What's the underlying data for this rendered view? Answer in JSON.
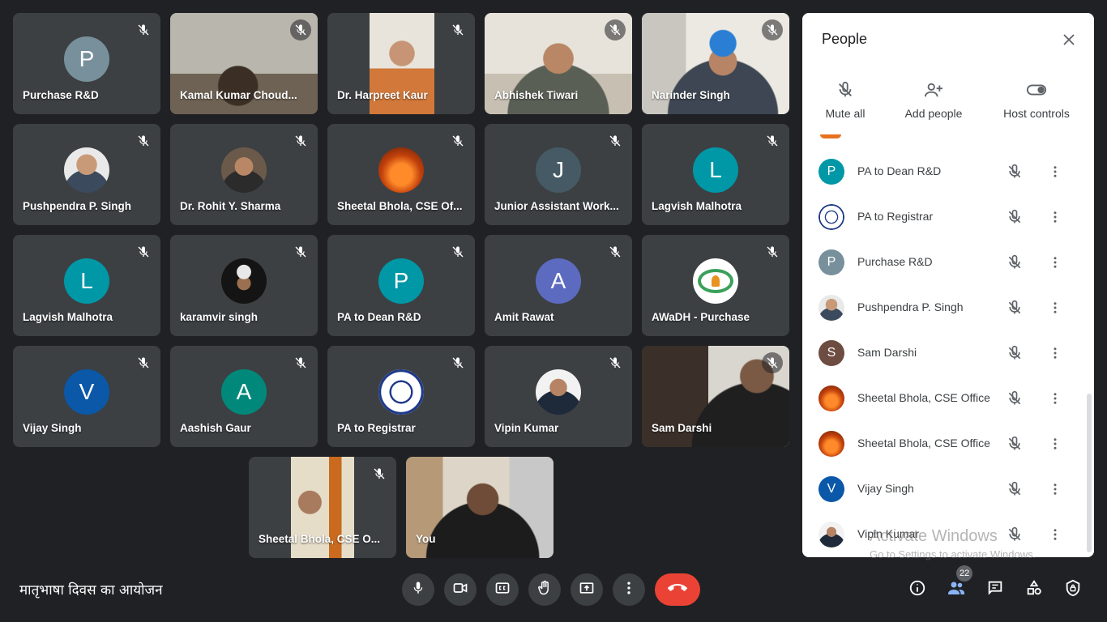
{
  "meeting": {
    "title": "मातृभाषा दिवस का आयोजन"
  },
  "tiles": [
    {
      "name": "Purchase R&D",
      "initial": "P",
      "color": "#78909c"
    },
    {
      "name": "Kamal Kumar Choud..."
    },
    {
      "name": "Dr. Harpreet Kaur"
    },
    {
      "name": "Abhishek Tiwari"
    },
    {
      "name": "Narinder Singh"
    },
    {
      "name": "Pushpendra P. Singh"
    },
    {
      "name": "Dr. Rohit Y. Sharma"
    },
    {
      "name": "Sheetal Bhola, CSE Of..."
    },
    {
      "name": "Junior Assistant Work...",
      "initial": "J",
      "color": "#455a64"
    },
    {
      "name": "Lagvish Malhotra",
      "initial": "L",
      "color": "#0097a7"
    },
    {
      "name": "Lagvish Malhotra",
      "initial": "L",
      "color": "#0097a7"
    },
    {
      "name": "karamvir singh"
    },
    {
      "name": "PA to Dean R&D",
      "initial": "P",
      "color": "#0097a7"
    },
    {
      "name": "Amit Rawat",
      "initial": "A",
      "color": "#5c6bc0"
    },
    {
      "name": "AWaDH - Purchase"
    },
    {
      "name": "Vijay Singh",
      "initial": "V",
      "color": "#0b57a8"
    },
    {
      "name": "Aashish Gaur",
      "initial": "A",
      "color": "#00897b"
    },
    {
      "name": "PA to Registrar"
    },
    {
      "name": "Vipin Kumar"
    },
    {
      "name": "Sam Darshi"
    },
    {
      "name": "Sheetal Bhola, CSE O..."
    },
    {
      "name": "You"
    }
  ],
  "controls": {
    "participant_count": "22"
  },
  "panel": {
    "title": "People",
    "actions": {
      "mute_all": "Mute all",
      "add_people": "Add people",
      "host_controls": "Host controls"
    },
    "participants": [
      {
        "name": "PA to Dean R&D",
        "initial": "P",
        "color": "#0097a7"
      },
      {
        "name": "PA to Registrar"
      },
      {
        "name": "Purchase R&D",
        "initial": "P",
        "color": "#78909c"
      },
      {
        "name": "Pushpendra P. Singh"
      },
      {
        "name": "Sam Darshi",
        "initial": "S",
        "color": "#6d4c41"
      },
      {
        "name": "Sheetal Bhola, CSE Office"
      },
      {
        "name": "Sheetal Bhola, CSE Office"
      },
      {
        "name": "Vijay Singh",
        "initial": "V",
        "color": "#0b57a8"
      },
      {
        "name": "Vipin Kumar"
      }
    ]
  },
  "watermark": {
    "line1": "Activate Windows",
    "line2": "Go to Settings to activate Windows."
  }
}
